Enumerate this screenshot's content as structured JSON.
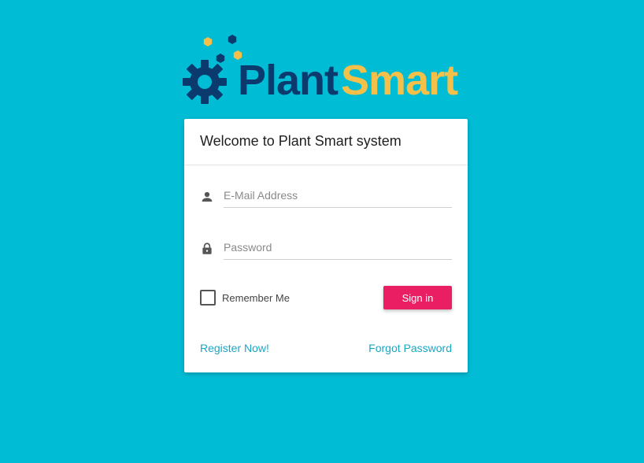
{
  "logo": {
    "part1": "Plant",
    "part2": "Smart",
    "colors": {
      "dark": "#0b3a6e",
      "accent": "#f4c04a"
    },
    "icons": [
      "gear-icon",
      "hexagon-dots"
    ]
  },
  "card": {
    "title": "Welcome to Plant Smart system"
  },
  "form": {
    "email": {
      "placeholder": "E-Mail Address",
      "value": "",
      "icon": "person-icon"
    },
    "password": {
      "placeholder": "Password",
      "value": "",
      "icon": "lock-icon"
    },
    "remember_label": "Remember Me",
    "remember_checked": false,
    "signin_label": "Sign in"
  },
  "links": {
    "register": "Register Now!",
    "forgot": "Forgot Password"
  },
  "colors": {
    "background": "#00bcd4",
    "button": "#e91e63",
    "link": "#1aa7c4"
  }
}
